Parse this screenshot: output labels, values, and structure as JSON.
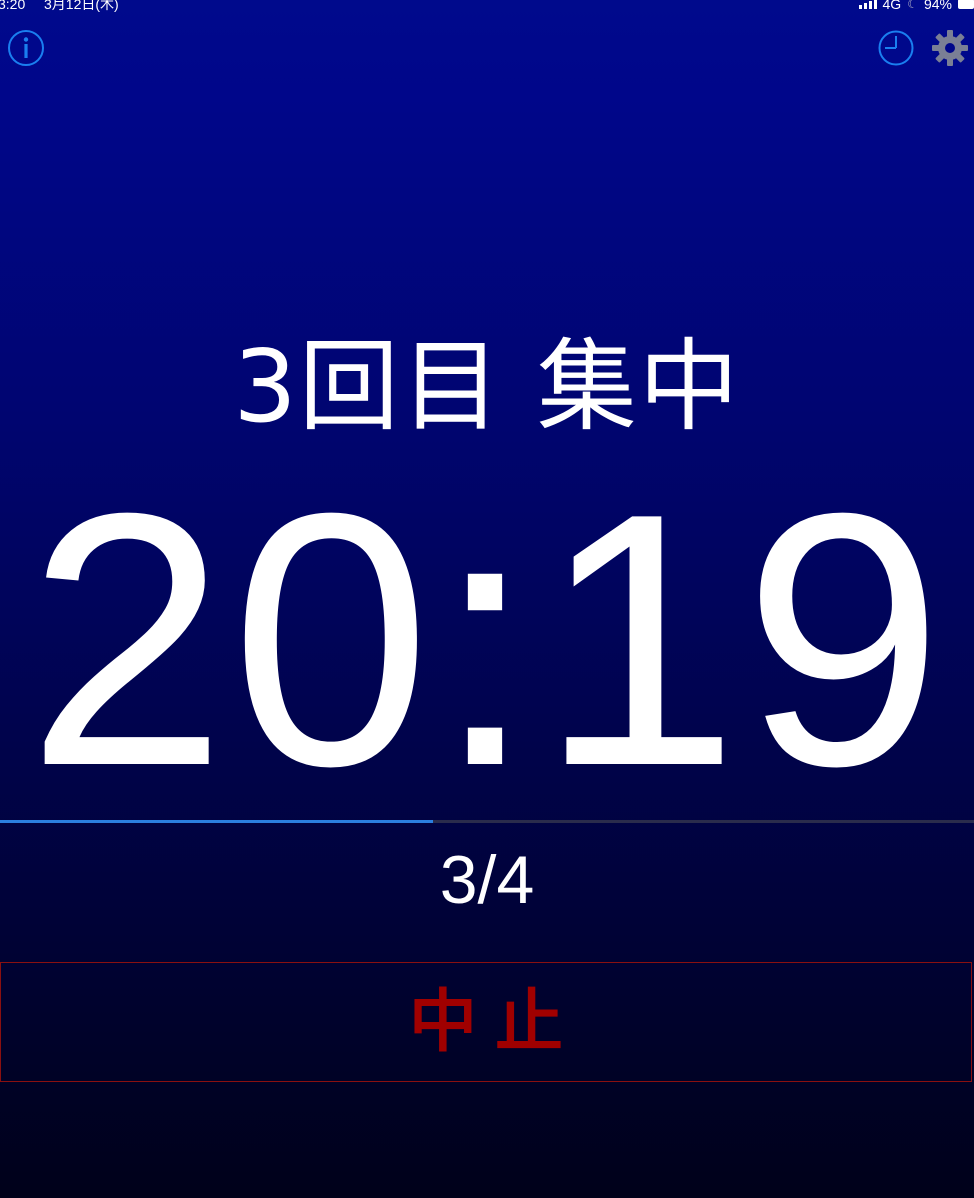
{
  "status_bar": {
    "time": "3:20",
    "date": "3月12日(木)",
    "network": "4G",
    "battery": "94%"
  },
  "toolbar": {
    "info_icon": "info-icon",
    "history_icon": "clock-icon",
    "settings_icon": "gear-icon"
  },
  "session": {
    "label": "3回目 集中",
    "timer": "20:19",
    "count": "3/4",
    "progress_fraction": 0.445
  },
  "actions": {
    "stop_label": "中止"
  },
  "colors": {
    "accent": "#2b7fe0",
    "stop": "#a00000",
    "icon_blue": "#1a7ff0",
    "icon_gray": "#7a7f95"
  }
}
